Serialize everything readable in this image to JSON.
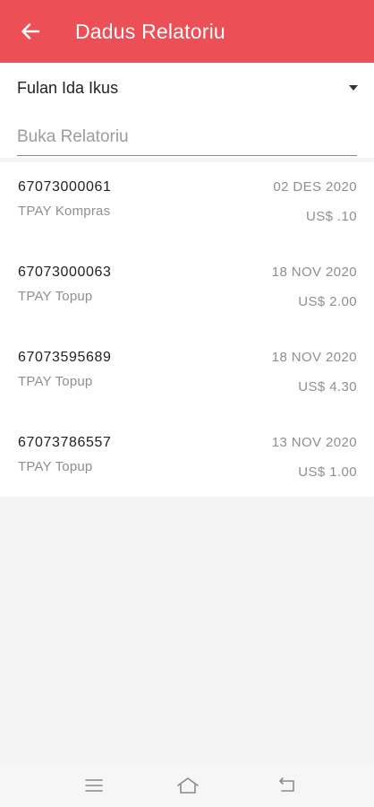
{
  "app_bar": {
    "title": "Dadus Relatoriu",
    "color": "#ed4f56",
    "back_icon": "arrow-left-icon"
  },
  "filter": {
    "selected_account": "Fulan Ida Ikus",
    "dropdown_icon": "triangle-down-icon",
    "search_placeholder": "Buka Relatoriu",
    "search_value": ""
  },
  "reports": [
    {
      "number": "67073000061",
      "description": "TPAY Kompras",
      "date": "02 DES 2020",
      "amount": "US$ .10"
    },
    {
      "number": "67073000063",
      "description": "TPAY Topup",
      "date": "18 NOV 2020",
      "amount": "US$ 2.00"
    },
    {
      "number": "67073595689",
      "description": "TPAY Topup",
      "date": "18 NOV 2020",
      "amount": "US$ 4.30"
    },
    {
      "number": "67073786557",
      "description": "TPAY Topup",
      "date": "13 NOV 2020",
      "amount": "US$ 1.00"
    }
  ],
  "nav_bar": {
    "menu_icon": "menu-icon",
    "home_icon": "home-icon",
    "back_icon": "back-icon"
  }
}
